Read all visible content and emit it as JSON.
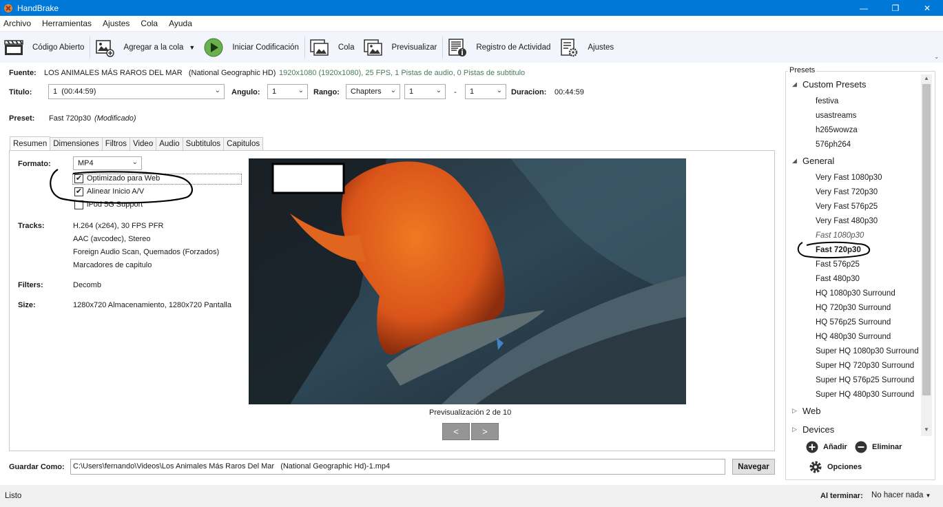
{
  "window": {
    "title": "HandBrake",
    "minimize_label": "—",
    "maximize_label": "❐",
    "close_label": "✕"
  },
  "menu": [
    "Archivo",
    "Herramientas",
    "Ajustes",
    "Cola",
    "Ayuda"
  ],
  "toolbar": {
    "open_source": "Código Abierto",
    "add_queue": "Agregar a la cola",
    "start": "Iniciar Codificación",
    "queue": "Cola",
    "preview": "Previsualizar",
    "activity": "Registro de Actividad",
    "settings": "Ajustes"
  },
  "source": {
    "label": "Fuente:",
    "name": "LOS ANIMALES MÁS RAROS DEL MAR   (National Geographic HD)",
    "info": "1920x1080 (1920x1080), 25 FPS, 1 Pistas de audio, 0 Pistas de subtitulo"
  },
  "title_row": {
    "title_label": "Titulo:",
    "title_value": "1  (00:44:59)",
    "angle_label": "Angulo:",
    "angle_value": "1",
    "range_label": "Rango:",
    "range_type": "Chapters",
    "range_start": "1",
    "range_dash": "-",
    "range_end": "1",
    "duration_label": "Duracion:",
    "duration_value": "00:44:59"
  },
  "preset": {
    "label": "Preset:",
    "name": "Fast 720p30",
    "modified": "(Modificado)"
  },
  "tabs": [
    "Resumen",
    "Dimensiones",
    "Filtros",
    "Video",
    "Audio",
    "Subtitulos",
    "Capitulos"
  ],
  "summary": {
    "format_label": "Formato:",
    "format_value": "MP4",
    "web_optimized": "Optimizado para Web",
    "web_optimized_checked": "✔",
    "align_av": "Alinear Inicio A/V",
    "align_av_checked": "✔",
    "ipod": "iPod 5G Support",
    "tracks_label": "Tracks:",
    "tracks": [
      "H.264 (x264), 30 FPS PFR",
      "AAC (avcodec), Stereo",
      "Foreign Audio Scan, Quemados (Forzados)",
      "Marcadores de capitulo"
    ],
    "filters_label": "Filters:",
    "filters_value": "Decomb",
    "size_label": "Size:",
    "size_value": "1280x720 Almacenamiento, 1280x720 Pantalla",
    "preview_caption": "Previsualización 2 de 10",
    "prev_btn": "<",
    "next_btn": ">"
  },
  "presets": {
    "title": "Presets",
    "groups": {
      "custom": "Custom Presets",
      "general": "General",
      "web": "Web",
      "devices": "Devices"
    },
    "custom_items": [
      "festiva",
      "usastreams",
      "h265wowza",
      "576ph264"
    ],
    "general_items": [
      "Very Fast 1080p30",
      "Very Fast 720p30",
      "Very Fast 576p25",
      "Very Fast 480p30",
      "Fast 1080p30",
      "Fast 720p30",
      "Fast 576p25",
      "Fast 480p30",
      "HQ 1080p30 Surround",
      "HQ 720p30 Surround",
      "HQ 576p25 Surround",
      "HQ 480p30 Surround",
      "Super HQ 1080p30 Surround",
      "Super HQ 720p30 Surround",
      "Super HQ 576p25 Surround",
      "Super HQ 480p30 Surround"
    ],
    "add": "Añadir",
    "remove": "Eliminar",
    "options": "Opciones"
  },
  "save": {
    "label": "Guardar Como:",
    "path": "C:\\Users\\fernando\\Videos\\Los Animales Más Raros Del Mar   (National Geographic Hd)-1.mp4",
    "browse": "Navegar"
  },
  "status": {
    "text": "Listo",
    "when_done_label": "Al terminar:",
    "when_done_value": "No hacer nada"
  },
  "colors": {
    "titlebar": "#0078d7",
    "toolbar_bg": "#f2f6fc",
    "status_bg": "#f0f0f0",
    "source_info": "#4a7a5c",
    "play_green": "#6ab04c"
  }
}
